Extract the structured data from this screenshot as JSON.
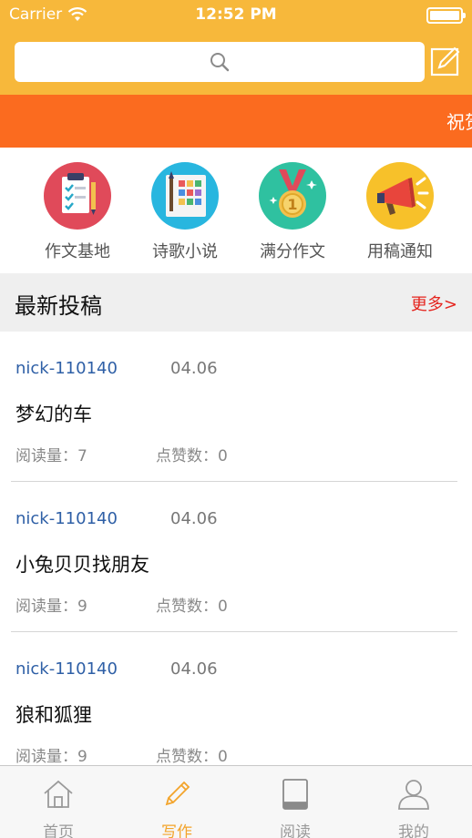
{
  "status_bar": {
    "carrier": "Carrier",
    "time": "12:52 PM"
  },
  "search": {
    "icon": "search-icon"
  },
  "banner": {
    "text": "祝贺"
  },
  "categories": [
    {
      "label": "作文基地",
      "icon": "writing-notebook-icon",
      "color": "#e04a5a"
    },
    {
      "label": "诗歌小说",
      "icon": "books-palette-icon",
      "color": "#28b6df"
    },
    {
      "label": "满分作文",
      "icon": "medal-icon",
      "color": "#2fc1a0"
    },
    {
      "label": "用稿通知",
      "icon": "megaphone-icon",
      "color": "#f7c12a"
    }
  ],
  "section": {
    "title": "最新投稿",
    "more": "更多>"
  },
  "posts": [
    {
      "author": "nick-110140",
      "date": "04.06",
      "title": "梦幻的车",
      "reads": "阅读量：7",
      "likes": "点赞数：0"
    },
    {
      "author": "nick-110140",
      "date": "04.06",
      "title": "小兔贝贝找朋友",
      "reads": "阅读量：9",
      "likes": "点赞数：0"
    },
    {
      "author": "nick-110140",
      "date": "04.06",
      "title": "狼和狐狸",
      "reads": "阅读量：9",
      "likes": "点赞数：0"
    }
  ],
  "tabs": [
    {
      "label": "首页",
      "icon": "home-icon"
    },
    {
      "label": "写作",
      "icon": "pencil-icon",
      "active": true
    },
    {
      "label": "阅读",
      "icon": "book-icon"
    },
    {
      "label": "我的",
      "icon": "person-icon"
    }
  ],
  "colors": {
    "header": "#f7b83b",
    "banner": "#fb6b1f",
    "author_link": "#2e5fa6",
    "more_link": "#e5241e",
    "tab_active": "#f3a42b"
  }
}
